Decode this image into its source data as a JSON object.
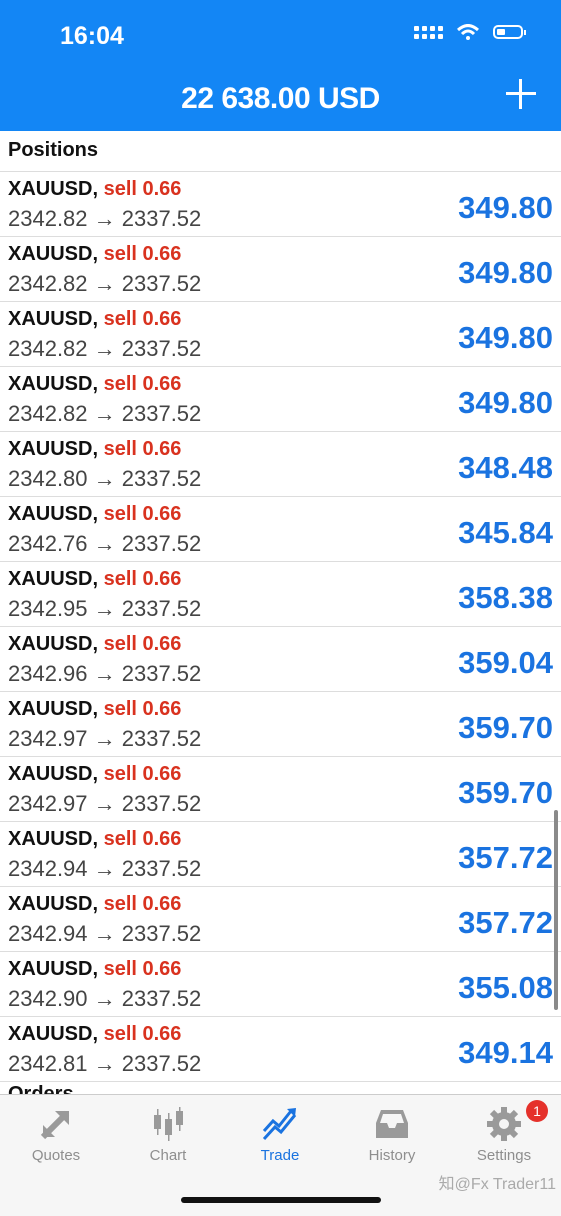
{
  "status": {
    "time": "16:04"
  },
  "header": {
    "balance": "22 638.00 USD"
  },
  "positions": {
    "title": "Positions",
    "rows": [
      {
        "symbol": "XAUUSD,",
        "side": "sell 0.66",
        "prices": "2342.82 → 2337.52",
        "profit": "349.80"
      },
      {
        "symbol": "XAUUSD,",
        "side": "sell 0.66",
        "prices": "2342.82 → 2337.52",
        "profit": "349.80"
      },
      {
        "symbol": "XAUUSD,",
        "side": "sell 0.66",
        "prices": "2342.82 → 2337.52",
        "profit": "349.80"
      },
      {
        "symbol": "XAUUSD,",
        "side": "sell 0.66",
        "prices": "2342.82 → 2337.52",
        "profit": "349.80"
      },
      {
        "symbol": "XAUUSD,",
        "side": "sell 0.66",
        "prices": "2342.80 → 2337.52",
        "profit": "348.48"
      },
      {
        "symbol": "XAUUSD,",
        "side": "sell 0.66",
        "prices": "2342.76 → 2337.52",
        "profit": "345.84"
      },
      {
        "symbol": "XAUUSD,",
        "side": "sell 0.66",
        "prices": "2342.95 → 2337.52",
        "profit": "358.38"
      },
      {
        "symbol": "XAUUSD,",
        "side": "sell 0.66",
        "prices": "2342.96 → 2337.52",
        "profit": "359.04"
      },
      {
        "symbol": "XAUUSD,",
        "side": "sell 0.66",
        "prices": "2342.97 → 2337.52",
        "profit": "359.70"
      },
      {
        "symbol": "XAUUSD,",
        "side": "sell 0.66",
        "prices": "2342.97 → 2337.52",
        "profit": "359.70"
      },
      {
        "symbol": "XAUUSD,",
        "side": "sell 0.66",
        "prices": "2342.94 → 2337.52",
        "profit": "357.72"
      },
      {
        "symbol": "XAUUSD,",
        "side": "sell 0.66",
        "prices": "2342.94 → 2337.52",
        "profit": "357.72"
      },
      {
        "symbol": "XAUUSD,",
        "side": "sell 0.66",
        "prices": "2342.90 → 2337.52",
        "profit": "355.08"
      },
      {
        "symbol": "XAUUSD,",
        "side": "sell 0.66",
        "prices": "2342.81 → 2337.52",
        "profit": "349.14"
      }
    ]
  },
  "orders_peek": "Orders",
  "tabs": [
    {
      "label": "Quotes",
      "icon": "quotes-icon"
    },
    {
      "label": "Chart",
      "icon": "chart-icon"
    },
    {
      "label": "Trade",
      "icon": "trade-icon",
      "active": true
    },
    {
      "label": "History",
      "icon": "history-icon"
    },
    {
      "label": "Settings",
      "icon": "settings-icon",
      "badge": "1"
    }
  ],
  "watermark": "知@Fx Trader11",
  "colors": {
    "header": "#1386f5",
    "profit": "#1a73e0",
    "sell": "#d9321f",
    "badge": "#e5312b"
  }
}
